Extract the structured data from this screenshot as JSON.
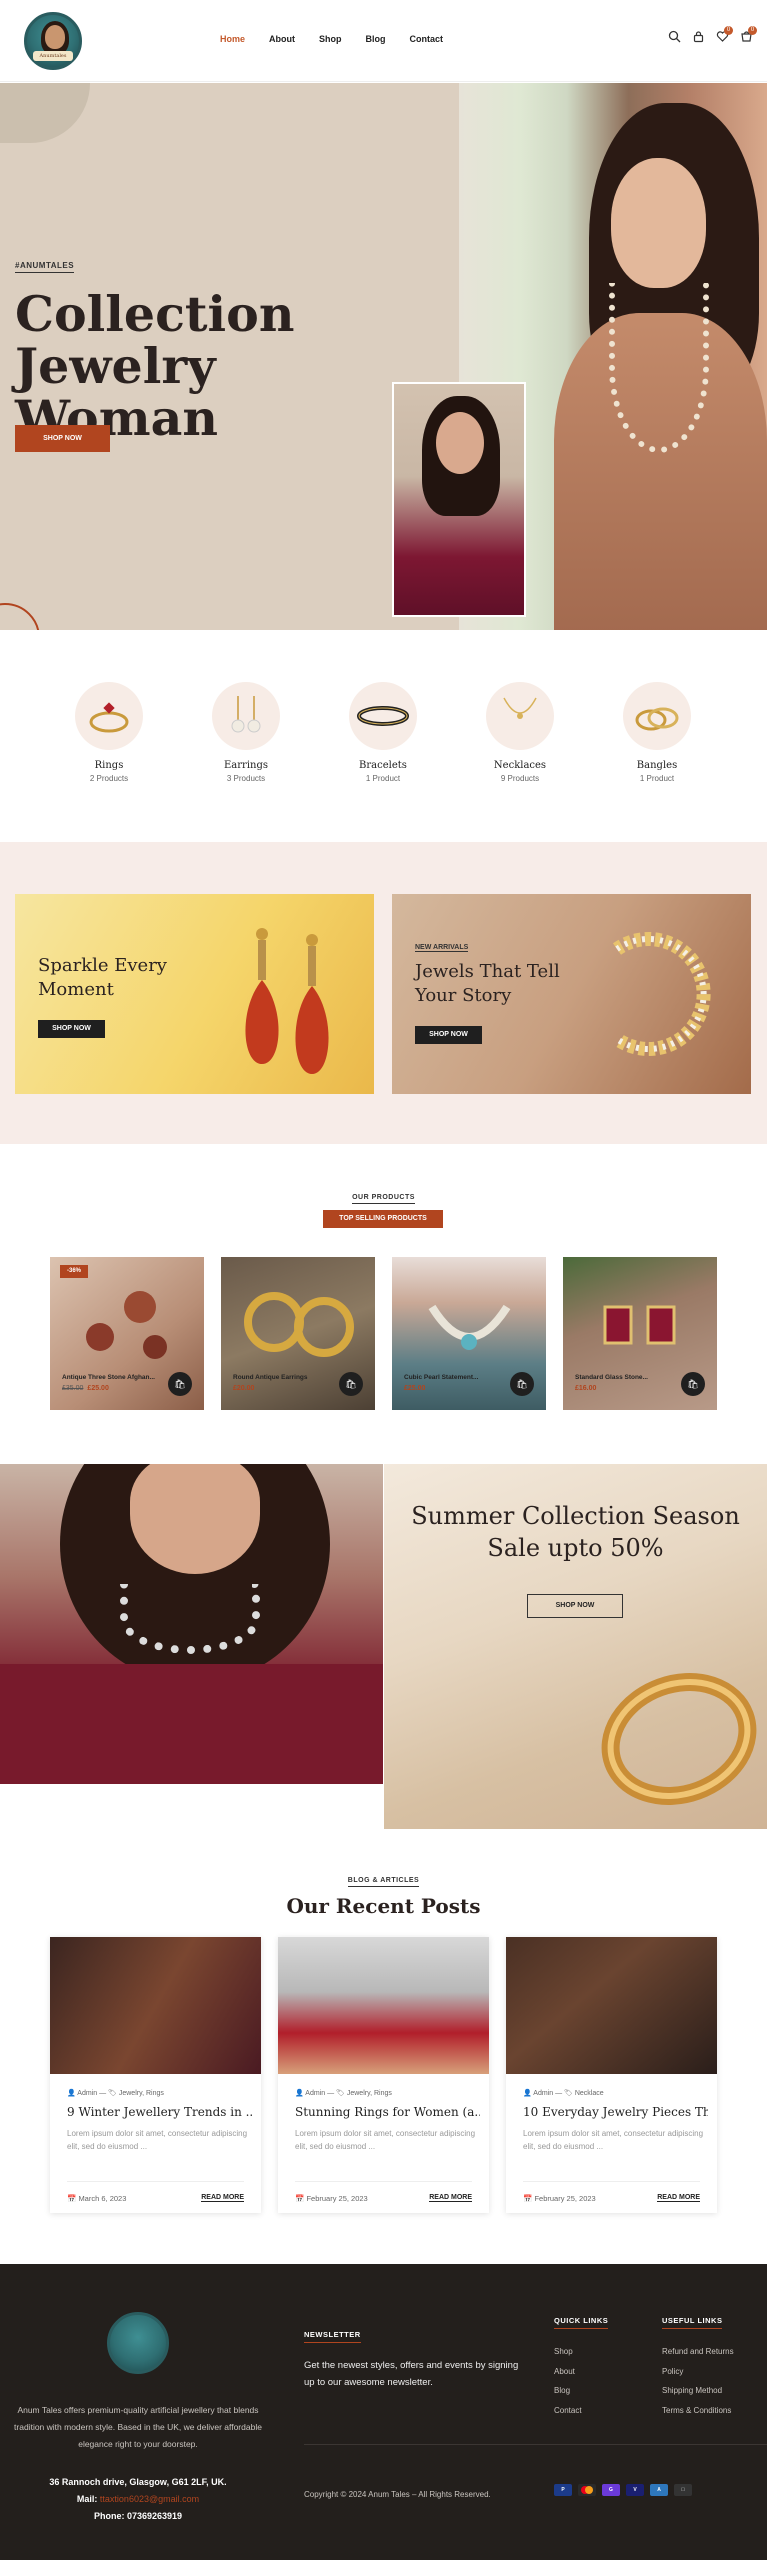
{
  "header": {
    "logo_text": "Anumtales",
    "nav": [
      {
        "label": "Home",
        "active": true
      },
      {
        "label": "About"
      },
      {
        "label": "Shop"
      },
      {
        "label": "Blog"
      },
      {
        "label": "Contact"
      }
    ],
    "icons": [
      "search-icon",
      "user-icon",
      "wishlist-icon",
      "cart-icon"
    ],
    "wishlist_count": "0",
    "cart_count": "0"
  },
  "hero": {
    "tag": "#ANUMTALES",
    "title": "Collection Jewelry Woman",
    "button": "SHOP NOW"
  },
  "categories": [
    {
      "name": "Rings",
      "count": "2 Products"
    },
    {
      "name": "Earrings",
      "count": "3 Products"
    },
    {
      "name": "Bracelets",
      "count": "1 Product"
    },
    {
      "name": "Necklaces",
      "count": "9 Products"
    },
    {
      "name": "Bangles",
      "count": "1 Product"
    }
  ],
  "promo": {
    "card1": {
      "title": "Sparkle Every Moment",
      "button": "SHOP NOW"
    },
    "card2": {
      "tag": "NEW ARRIVALS",
      "title": "Jewels That Tell Your Story",
      "button": "SHOP NOW"
    }
  },
  "products": {
    "label": "OUR PRODUCTS",
    "pill": "TOP SELLING PRODUCTS",
    "items": [
      {
        "name": "Antique Three Stone Afghan...",
        "old_price": "£35.00",
        "price": "£25.00",
        "badge": "-36%"
      },
      {
        "name": "Round Antique Earrings",
        "old_price": "",
        "price": "£20.00",
        "badge": ""
      },
      {
        "name": "Cubic Pearl Statement...",
        "old_price": "",
        "price": "£25.00",
        "badge": ""
      },
      {
        "name": "Standard Glass Stone...",
        "old_price": "",
        "price": "£16.00",
        "badge": ""
      }
    ]
  },
  "banner": {
    "title": "Summer Collection Season Sale upto 50%",
    "button": "SHOP NOW"
  },
  "blog": {
    "label": "BLOG & ARTICLES",
    "title": "Our Recent Posts",
    "posts": [
      {
        "author": "Admin",
        "cats": "Jewelry, Rings",
        "title": "9 Winter Jewellery Trends in ...",
        "excerpt": "Lorem ipsum dolor sit amet, consectetur adipiscing elit, sed do eiusmod ...",
        "date": "March 6, 2023",
        "read": "READ MORE"
      },
      {
        "author": "Admin",
        "cats": "Jewelry, Rings",
        "title": "Stunning Rings for Women (a...",
        "excerpt": "Lorem ipsum dolor sit amet, consectetur adipiscing elit, sed do eiusmod ...",
        "date": "February 25, 2023",
        "read": "READ MORE"
      },
      {
        "author": "Admin",
        "cats": "Necklace",
        "title": "10 Everyday Jewelry Pieces Th...",
        "excerpt": "Lorem ipsum dolor sit amet, consectetur adipiscing elit, sed do eiusmod ...",
        "date": "February 25, 2023",
        "read": "READ MORE"
      }
    ]
  },
  "footer": {
    "description": "Anum Tales offers premium-quality artificial jewellery that blends tradition with modern style. Based in the UK, we deliver affordable elegance right to your doorstep.",
    "address": "36 Rannoch drive, Glasgow, G61 2LF, UK.",
    "mail_label": "Mail:",
    "mail": "ttaxtion6023@gmail.com",
    "phone_label": "Phone:",
    "phone": "07369263919",
    "newsletter_head": "NEWSLETTER",
    "newsletter_text": "Get the newest styles, offers and events by signing up to our awesome newsletter.",
    "quick_head": "QUICK LINKS",
    "quick_links": [
      "Shop",
      "About",
      "Blog",
      "Contact"
    ],
    "useful_head": "USEFUL LINKS",
    "useful_links": [
      "Refund and Returns Policy",
      "Shipping Method",
      "Terms & Conditions"
    ],
    "copyright": "Copyright © 2024 Anum Tales – All Rights Reserved.",
    "payments": [
      "paypal-icon",
      "mastercard-icon",
      "gpay-icon",
      "visa-icon",
      "amex-icon",
      "applepay-icon"
    ]
  },
  "colors": {
    "accent": "#b1451f",
    "hero_bg": "#dccfc0",
    "promo_bg": "#f7ece8",
    "footer_bg": "#231f1c"
  }
}
